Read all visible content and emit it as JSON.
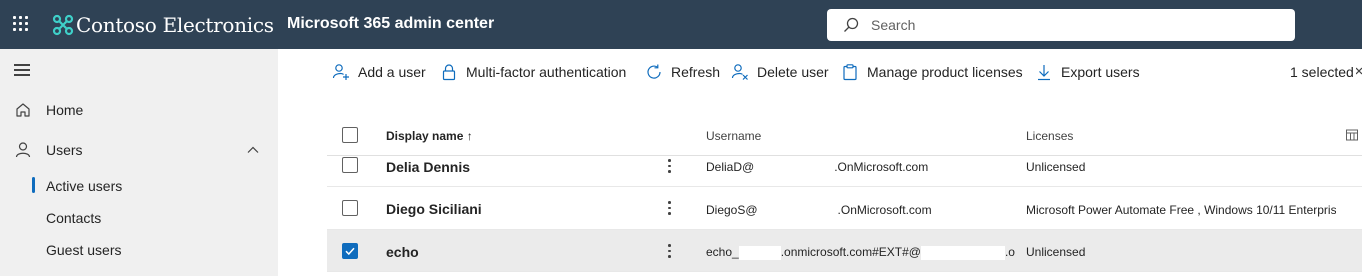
{
  "header": {
    "brand": "Contoso Electronics",
    "app_title": "Microsoft 365 admin center",
    "search_placeholder": "Search",
    "colors": {
      "header_bg": "#2f4255",
      "accent": "#0f6cbd"
    }
  },
  "sidebar": {
    "items": [
      {
        "label": "Home",
        "icon": "home-icon"
      },
      {
        "label": "Users",
        "icon": "person-icon",
        "expanded": true
      }
    ],
    "subitems": [
      {
        "label": "Active users",
        "active": true
      },
      {
        "label": "Contacts"
      },
      {
        "label": "Guest users"
      }
    ]
  },
  "toolbar": {
    "add_user": "Add a user",
    "mfa": "Multi-factor authentication",
    "refresh": "Refresh",
    "delete_user": "Delete user",
    "manage_licenses": "Manage product licenses",
    "export_users": "Export users",
    "selected_count": "1 selected"
  },
  "table": {
    "columns": {
      "display_name": "Display name ↑",
      "username": "Username",
      "licenses": "Licenses"
    },
    "rows": [
      {
        "name": "Delia Dennis",
        "username_prefix": "DeliaD@",
        "username_suffix": ".OnMicrosoft.com",
        "licenses": "Unlicensed",
        "selected": false
      },
      {
        "name": "Diego Siciliani",
        "username_prefix": "DiegoS@",
        "username_suffix": ".OnMicrosoft.com",
        "licenses": "Microsoft Power Automate Free , Windows 10/11 Enterpris",
        "selected": false
      },
      {
        "name": "echo",
        "username_prefix": "echo_",
        "username_middle": ".onmicrosoft.com#EXT#@",
        "username_suffix": ".or",
        "licenses": "Unlicensed",
        "selected": true
      }
    ]
  }
}
